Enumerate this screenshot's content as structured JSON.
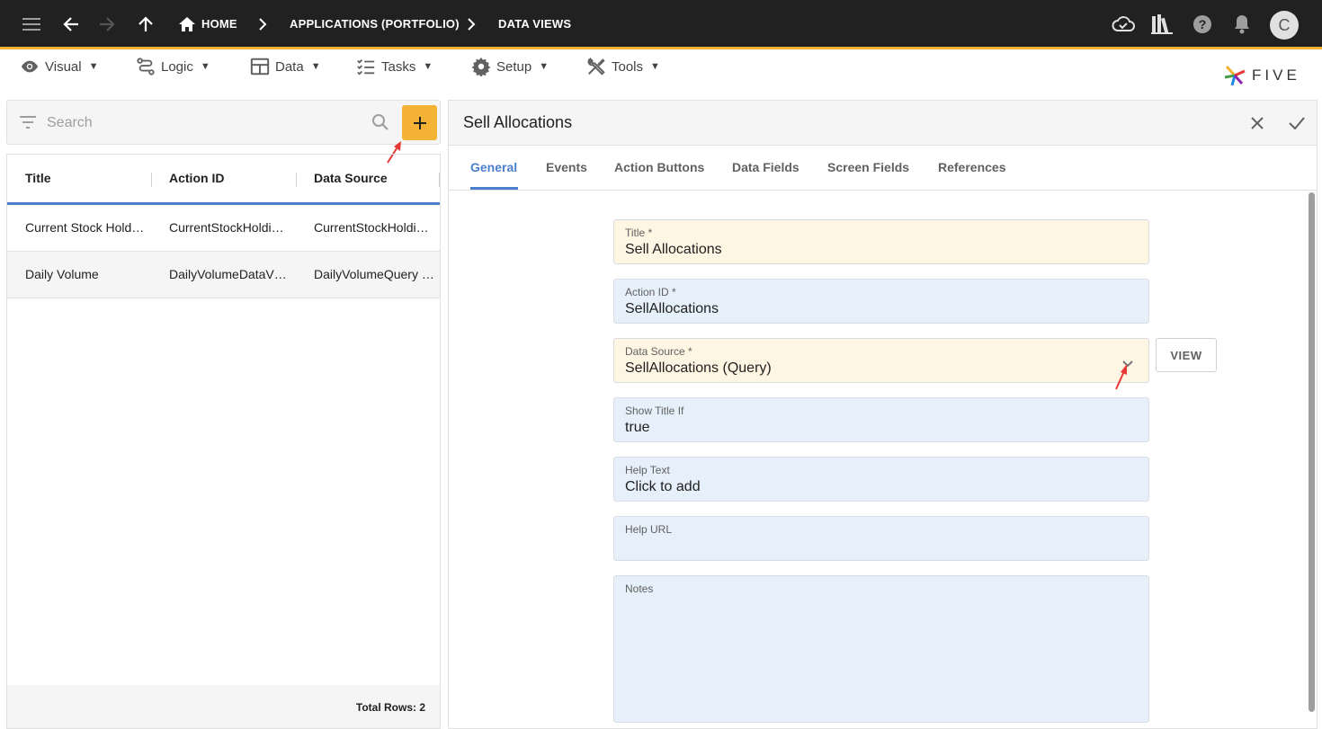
{
  "appbar": {
    "breadcrumbs": [
      "HOME",
      "APPLICATIONS (PORTFOLIO)",
      "DATA VIEWS"
    ],
    "avatar_initial": "C"
  },
  "menus": [
    {
      "label": "Visual",
      "icon": "eye-icon"
    },
    {
      "label": "Logic",
      "icon": "logic-icon"
    },
    {
      "label": "Data",
      "icon": "table-icon"
    },
    {
      "label": "Tasks",
      "icon": "tasks-icon"
    },
    {
      "label": "Setup",
      "icon": "gear-icon"
    },
    {
      "label": "Tools",
      "icon": "tools-icon"
    }
  ],
  "menu_caret": "▼",
  "logo": {
    "text": "FIVE"
  },
  "left": {
    "search": {
      "placeholder": "Search"
    },
    "columns": [
      "Title",
      "Action ID",
      "Data Source"
    ],
    "rows": [
      [
        "Current Stock Hold…",
        "CurrentStockHoldi…",
        "CurrentStockHoldi…"
      ],
      [
        "Daily Volume",
        "DailyVolumeDataV…",
        "DailyVolumeQuery …"
      ]
    ],
    "total_rows": "Total Rows: 2"
  },
  "form": {
    "title": "Sell Allocations",
    "tabs": [
      "General",
      "Events",
      "Action Buttons",
      "Data Fields",
      "Screen Fields",
      "References"
    ],
    "active_tab": "General",
    "fields": [
      {
        "label": "Title *",
        "value": "Sell Allocations",
        "required": true
      },
      {
        "label": "Action ID *",
        "value": "SellAllocations",
        "required": false
      },
      {
        "label": "Data Source *",
        "value": "SellAllocations (Query)",
        "required": true
      },
      {
        "label": "Show Title If",
        "value": "true",
        "required": false
      },
      {
        "label": "Help Text",
        "value": "Click to add",
        "required": false
      },
      {
        "label": "Help URL",
        "value": "",
        "required": false
      },
      {
        "label": "Notes",
        "value": "",
        "required": false
      }
    ],
    "view_button": "VIEW"
  },
  "colors": {
    "appbar_bg": "#212121",
    "accent": "#f5b335",
    "tab_active": "#4a7fce",
    "required_field_bg": "#fff5e3",
    "optional_field_bg": "#e5f0fb",
    "annotation_arrow": "#e53935"
  }
}
